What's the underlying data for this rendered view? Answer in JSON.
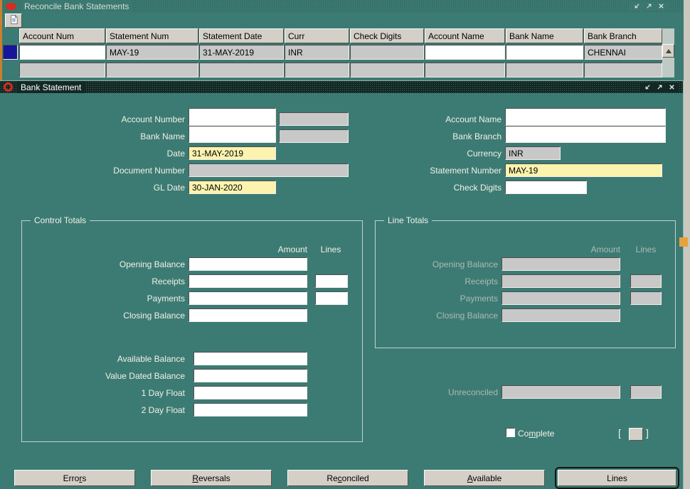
{
  "colors": {
    "bg-teal": "#3C7B73",
    "titlebar-dark": "#132824",
    "titlebar-teal": "#3A7870",
    "field-gray": "#C8C8C8",
    "field-yellow": "#FBF3AE",
    "btn-face": "#D4D0C8",
    "selector-blue": "#16169B",
    "accent-strip": "#C9802C",
    "accent-marker": "#E8A23B",
    "label-light": "#F2F2E9",
    "label-dim": "#ADBAB5",
    "scroll-track": "#BFCAC6",
    "right-strip": "#CBC7BF",
    "group-border": "#C3D3CF"
  },
  "icons": {
    "oracle-logo": "red-ellipse",
    "oracle-ring-logo": "red-ring",
    "restore-icon": "diagonal-arrow-down-left",
    "maximize-icon": "diagonal-arrow-up-right",
    "close-icon": "x-cross",
    "document-icon": "torn-page",
    "scroll-up-icon": "triangle-up"
  },
  "reconcile_window": {
    "title": "Reconcile Bank Statements",
    "columns": [
      "Account Num",
      "Statement Num",
      "Statement Date",
      "Curr",
      "Check Digits",
      "Account Name",
      "Bank Name",
      "Bank Branch"
    ],
    "row1": {
      "account_num": "",
      "statement_num": "MAY-19",
      "statement_date": "31-MAY-2019",
      "curr": "INR",
      "check_digits": "",
      "account_name": "",
      "bank_name": "",
      "bank_branch": "CHENNAI"
    }
  },
  "statement_window": {
    "title": "Bank Statement",
    "labels": {
      "account_number": "Account Number",
      "bank_name": "Bank Name",
      "date": "Date",
      "document_number": "Document Number",
      "gl_date": "GL Date",
      "account_name": "Account Name",
      "bank_branch": "Bank Branch",
      "currency": "Currency",
      "statement_number": "Statement Number",
      "check_digits": "Check Digits",
      "unreconciled": "Unreconciled"
    },
    "values": {
      "account_number": "",
      "bank_name": "",
      "date": "31-MAY-2019",
      "document_number": "",
      "gl_date": "30-JAN-2020",
      "account_name": "",
      "bank_branch": "",
      "currency": "INR",
      "statement_number": "MAY-19",
      "check_digits": ""
    },
    "control_totals": {
      "title": "Control Totals",
      "amount_header": "Amount",
      "lines_header": "Lines",
      "labels": [
        "Opening Balance",
        "Receipts",
        "Payments",
        "Closing Balance"
      ],
      "extra_labels": [
        "Available Balance",
        "Value Dated Balance",
        "1 Day Float",
        "2 Day Float"
      ]
    },
    "line_totals": {
      "title": "Line Totals",
      "amount_header": "Amount",
      "lines_header": "Lines",
      "labels": [
        "Opening Balance",
        "Receipts",
        "Payments",
        "Closing Balance"
      ]
    },
    "complete": {
      "pre": "Co",
      "key": "m",
      "post": "plete"
    },
    "bracket_open": "[",
    "bracket_close": "]",
    "buttons": [
      {
        "pre": "Erro",
        "key": "r",
        "post": "s"
      },
      {
        "pre": "",
        "key": "R",
        "post": "eversals"
      },
      {
        "pre": "Re",
        "key": "c",
        "post": "onciled"
      },
      {
        "pre": "",
        "key": "A",
        "post": "vailable"
      },
      {
        "pre": "Lines",
        "key": "",
        "post": ""
      }
    ]
  }
}
